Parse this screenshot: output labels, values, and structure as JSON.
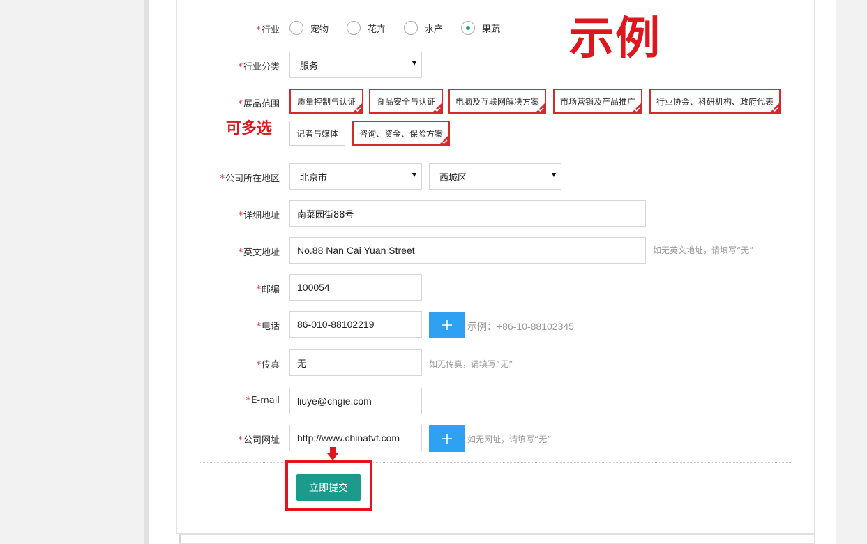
{
  "form": {
    "industry": {
      "label": "行业",
      "options": [
        {
          "label": "宠物",
          "checked": false
        },
        {
          "label": "花卉",
          "checked": false
        },
        {
          "label": "水产",
          "checked": false
        },
        {
          "label": "果蔬",
          "checked": true
        }
      ]
    },
    "industry_category": {
      "label": "行业分类",
      "value": "服务"
    },
    "exhibit_scope": {
      "label": "展品范围",
      "tags": [
        {
          "label": "质量控制与认证",
          "selected": true
        },
        {
          "label": "食品安全与认证",
          "selected": true
        },
        {
          "label": "电脑及互联网解决方案",
          "selected": true
        },
        {
          "label": "市场营销及产品推广",
          "selected": true
        },
        {
          "label": "行业协会、科研机构、政府代表",
          "selected": true
        },
        {
          "label": "记者与媒体",
          "selected": false
        },
        {
          "label": "咨询、资金、保险方案",
          "selected": true
        }
      ]
    },
    "company_region": {
      "label": "公司所在地区",
      "city": "北京市",
      "district": "西城区"
    },
    "address": {
      "label": "详细地址",
      "value": "南菜园街88号"
    },
    "english_address": {
      "label": "英文地址",
      "value": "No.88 Nan Cai Yuan Street",
      "hint": "如无英文地址，请填写“无”"
    },
    "postcode": {
      "label": "邮编",
      "value": "100054"
    },
    "phone": {
      "label": "电话",
      "value": "86-010-88102219",
      "hint": "示例：+86-10-88102345"
    },
    "fax": {
      "label": "传真",
      "value": "无",
      "hint": "如无传真，请填写“无”"
    },
    "email": {
      "label": "E-mail",
      "value": "liuye@chgie.com"
    },
    "website": {
      "label": "公司网址",
      "value": "http://www.chinafvf.com",
      "hint": "如无网址，请填写“无”"
    },
    "submit_label": "立即提交",
    "required_mark": "*"
  },
  "annotations": {
    "example_stamp": "示例",
    "multi_select_note": "可多选"
  },
  "icons": {
    "plus": "plus-icon",
    "check": "check-icon",
    "caret": "caret-down-icon",
    "arrow": "arrow-down-icon"
  },
  "colors": {
    "accent_green": "#1a9b8c",
    "plus_blue": "#2ea1f2",
    "required_red": "#e02a2a",
    "annotation_red": "#e0151e",
    "tag_selected_red": "#d8262d"
  }
}
